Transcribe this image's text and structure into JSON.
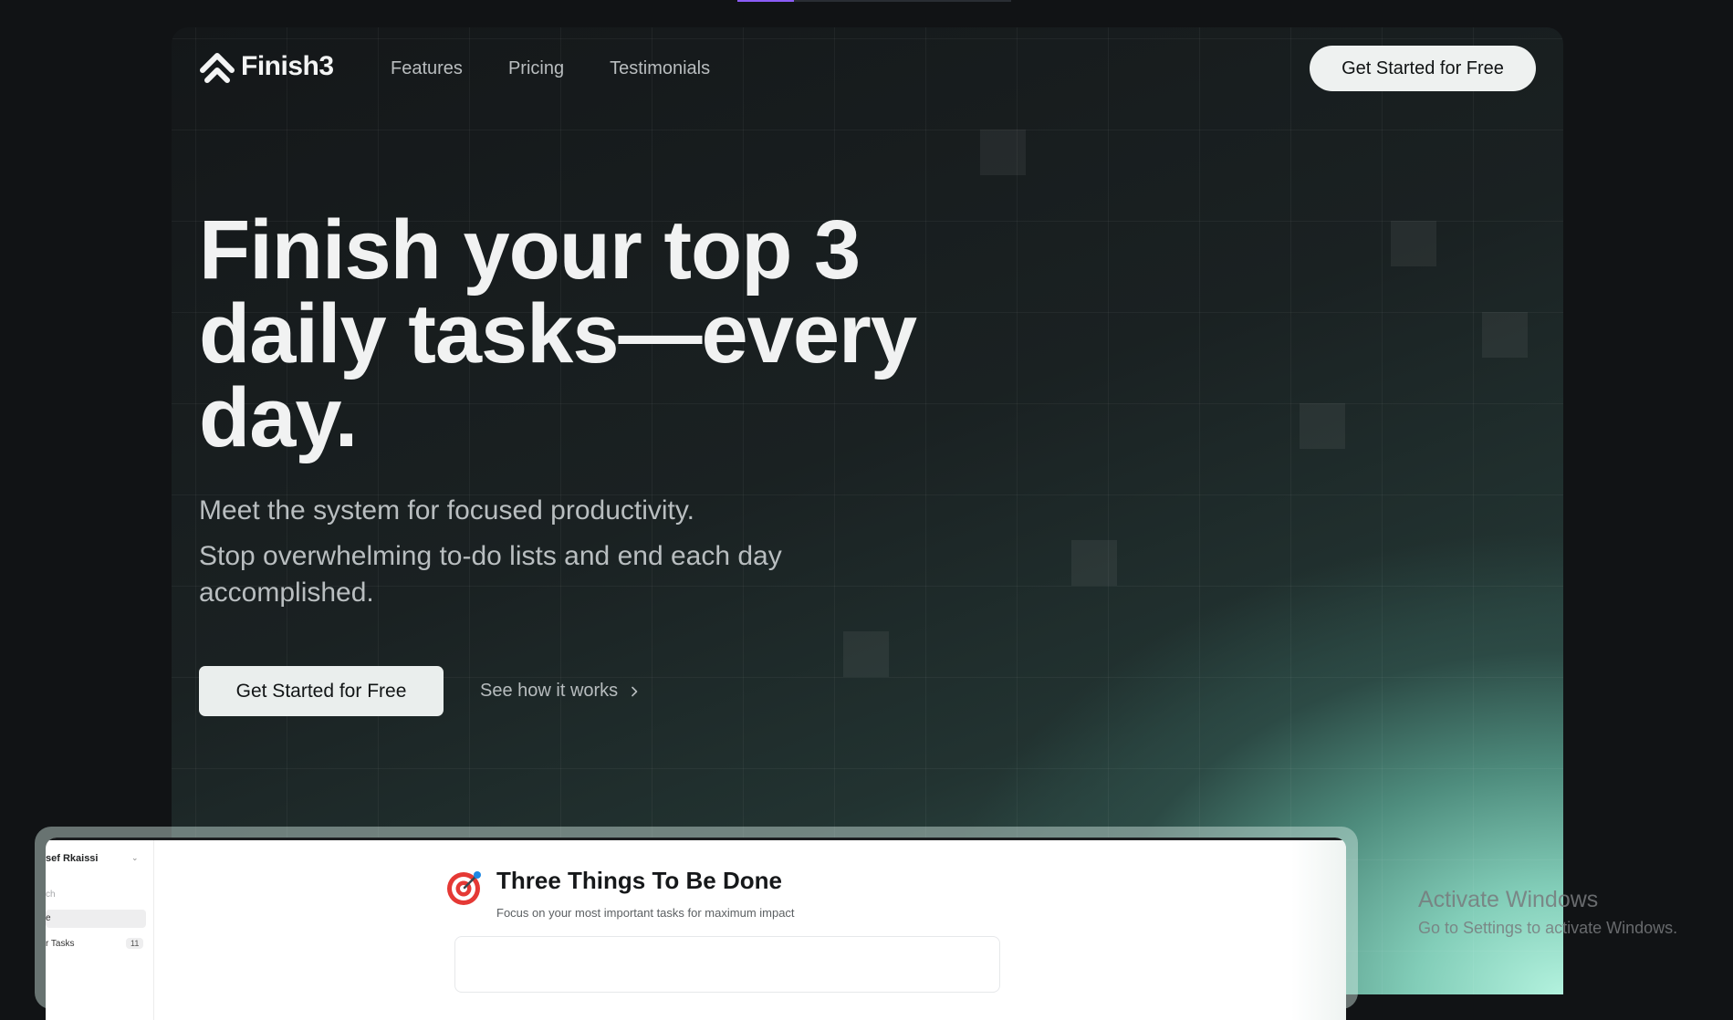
{
  "brand": {
    "name": "Finish3"
  },
  "nav": {
    "items": [
      {
        "label": "Features"
      },
      {
        "label": "Pricing"
      },
      {
        "label": "Testimonials"
      }
    ]
  },
  "header": {
    "cta_label": "Get Started for Free"
  },
  "hero": {
    "headline": "Finish your top 3 daily tasks—every day.",
    "subtitle_1": "Meet the system for focused productivity.",
    "subtitle_2": "Stop overwhelming to-do lists and end each day accomplished.",
    "primary_cta": "Get Started for Free",
    "secondary_cta": "See how it works"
  },
  "preview": {
    "sidebar": {
      "user": "sef Rkaissi",
      "search": "ch",
      "active_item": "e",
      "tasks_label": "r Tasks",
      "tasks_count": "11"
    },
    "title": "Three Things To Be Done",
    "subtitle": "Focus on your most important tasks for maximum impact"
  },
  "watermark": {
    "line1": "Activate Windows",
    "line2": "Go to Settings to activate Windows."
  },
  "colors": {
    "accent": "#8b5cf6",
    "background": "#111315",
    "button_bg": "#eef1f0",
    "glow": "#b3f2de"
  }
}
